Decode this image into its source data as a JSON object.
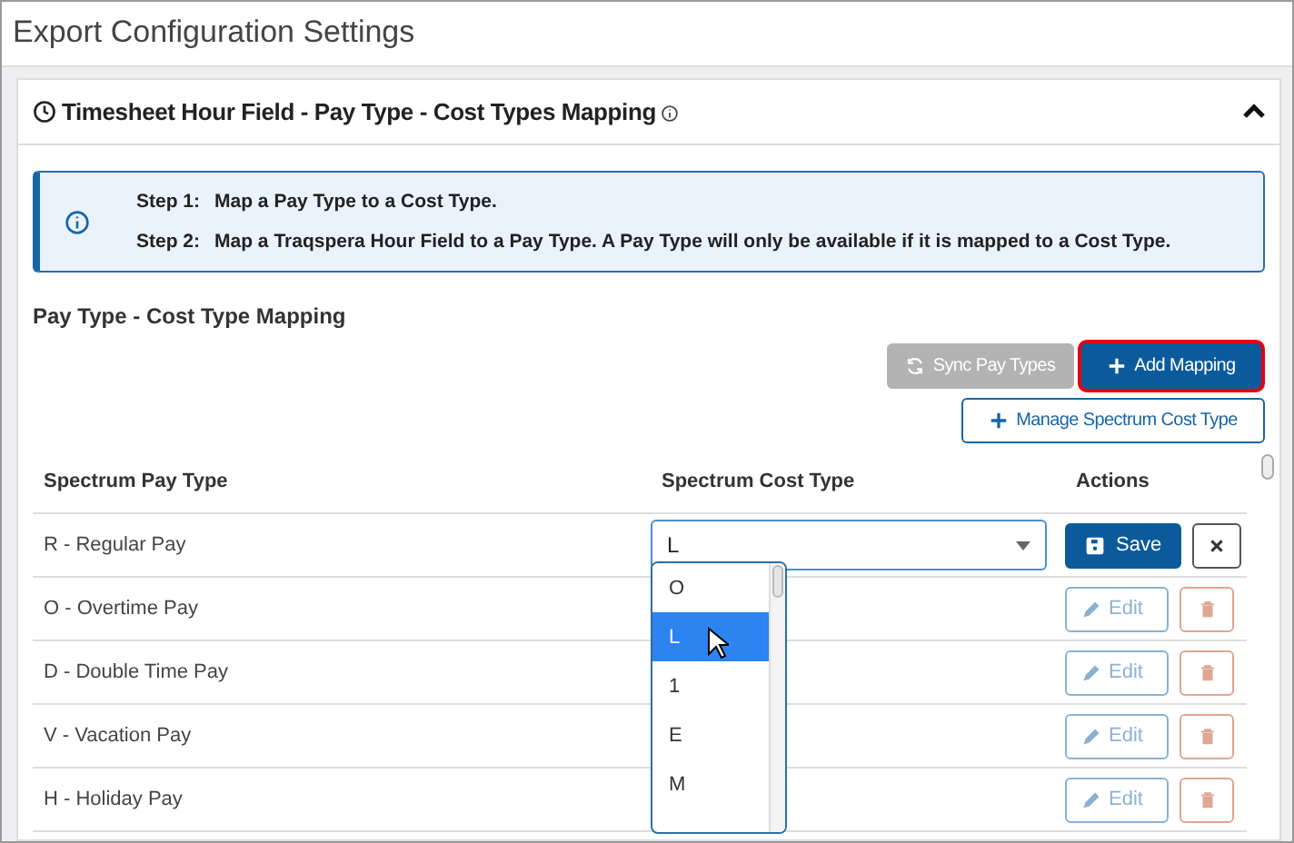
{
  "page": {
    "title": "Export Configuration Settings"
  },
  "section": {
    "title": "Timesheet Hour Field - Pay Type - Cost Types Mapping",
    "expanded": true
  },
  "info": {
    "steps": [
      {
        "label": "Step 1:",
        "text": "Map a Pay Type to a Cost Type."
      },
      {
        "label": "Step 2:",
        "text": "Map a Traqspera Hour Field to a Pay Type. A Pay Type will only be available if it is mapped to a Cost Type."
      }
    ]
  },
  "mapping": {
    "heading": "Pay Type - Cost Type Mapping",
    "sync_button": {
      "label": "Sync Pay Types",
      "disabled": true
    },
    "add_button": {
      "label": "Add Mapping",
      "focused": true
    },
    "manage_button": {
      "label": "Manage Spectrum Cost Type"
    }
  },
  "table": {
    "columns": [
      "Spectrum Pay Type",
      "Spectrum Cost Type",
      "Actions"
    ],
    "rows": [
      {
        "pay_type": "R - Regular Pay",
        "editing": true,
        "cost_type": "L",
        "save": "Save"
      },
      {
        "pay_type": "O - Overtime Pay",
        "editing": false,
        "edit": "Edit",
        "disabled": true
      },
      {
        "pay_type": "D - Double Time Pay",
        "editing": false,
        "edit": "Edit",
        "disabled": true
      },
      {
        "pay_type": "V - Vacation Pay",
        "editing": false,
        "edit": "Edit",
        "disabled": true
      },
      {
        "pay_type": "H - Holiday Pay",
        "editing": false,
        "edit": "Edit",
        "disabled": true
      }
    ]
  },
  "dropdown": {
    "options": [
      {
        "label": "O",
        "selected": false
      },
      {
        "label": "L",
        "selected": true
      },
      {
        "label": "1",
        "selected": false
      },
      {
        "label": "E",
        "selected": false
      },
      {
        "label": "M",
        "selected": false
      }
    ]
  }
}
